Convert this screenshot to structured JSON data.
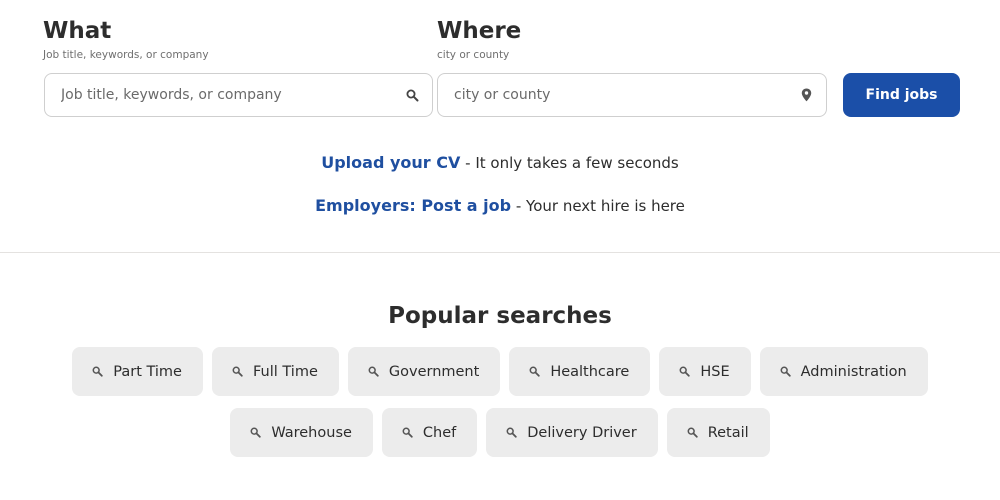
{
  "search": {
    "what": {
      "title": "What",
      "subtitle": "Job title, keywords, or company",
      "placeholder": "Job title, keywords, or company",
      "value": ""
    },
    "where": {
      "title": "Where",
      "subtitle": "city or county",
      "placeholder": "city or county",
      "value": ""
    },
    "button_label": "Find jobs"
  },
  "promos": {
    "cv": {
      "link": "Upload your CV",
      "text": " - It only takes a few seconds"
    },
    "employers": {
      "link": "Employers: Post a job",
      "text": " - Your next hire is here"
    }
  },
  "popular": {
    "title": "Popular searches",
    "row1": [
      "Part Time",
      "Full Time",
      "Government",
      "Healthcare",
      "HSE",
      "Administration"
    ],
    "row2": [
      "Warehouse",
      "Chef",
      "Delivery Driver",
      "Retail"
    ]
  },
  "colors": {
    "primary": "#1b4fa8",
    "link": "#1f4fa0",
    "pill_bg": "#ececec"
  },
  "icons": {
    "what_field": "search-icon",
    "where_field": "location-pin-icon",
    "pills": "search-icon"
  }
}
